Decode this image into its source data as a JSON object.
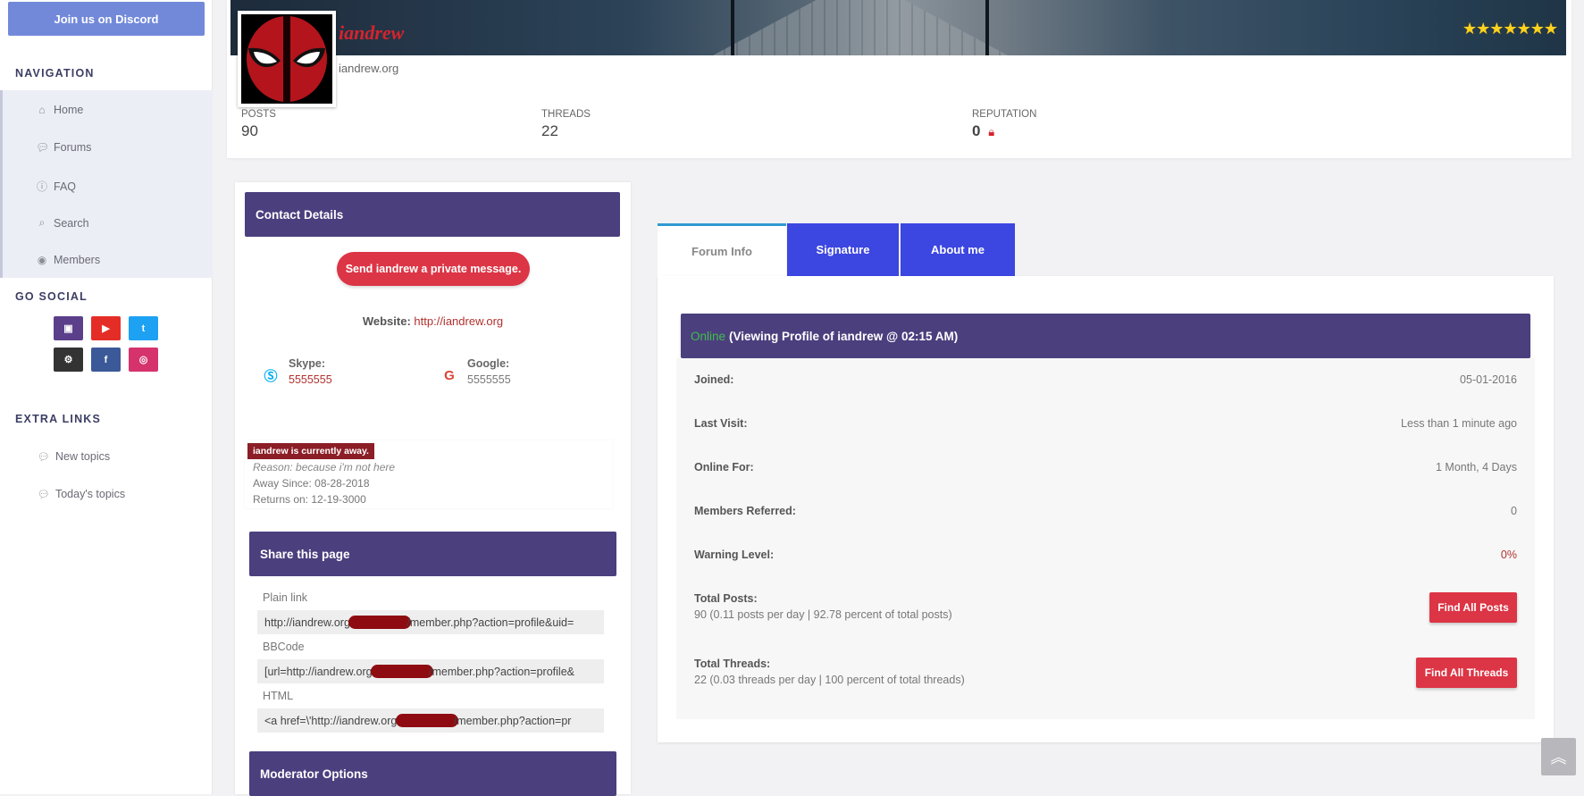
{
  "sidebar": {
    "discord_label": "Join us on Discord",
    "nav_heading": "NAVIGATION",
    "nav_items": [
      {
        "label": "Home",
        "icon": "home-icon"
      },
      {
        "label": "Forums",
        "icon": "comment-icon"
      },
      {
        "label": "FAQ",
        "icon": "question-icon"
      },
      {
        "label": "Search",
        "icon": "search-icon"
      },
      {
        "label": "Members",
        "icon": "user-icon"
      }
    ],
    "social_heading": "GO SOCIAL",
    "social": [
      {
        "name": "twitch-icon",
        "color": "#5b3f8a",
        "glyph": "▣"
      },
      {
        "name": "youtube-icon",
        "color": "#e52d27",
        "glyph": "▶"
      },
      {
        "name": "twitter-icon",
        "color": "#1da1f2",
        "glyph": "t"
      },
      {
        "name": "steam-icon",
        "color": "#333333",
        "glyph": "⚙"
      },
      {
        "name": "facebook-icon",
        "color": "#3b5998",
        "glyph": "f"
      },
      {
        "name": "instagram-icon",
        "color": "#d6336c",
        "glyph": "◎"
      }
    ],
    "extra_heading": "EXTRA LINKS",
    "extra_items": [
      {
        "label": "New topics",
        "icon": "comment-icon"
      },
      {
        "label": "Today's topics",
        "icon": "comment-icon"
      }
    ]
  },
  "profile": {
    "username": "iandrew",
    "user_title": "iandrew.org",
    "stars": "★★★★★★★",
    "stats": {
      "posts_label": "POSTS",
      "posts": "90",
      "threads_label": "THREADS",
      "threads": "22",
      "reputation_label": "REPUTATION",
      "reputation": "0"
    }
  },
  "contact": {
    "heading": "Contact Details",
    "pm_button": "Send iandrew a private message.",
    "website_label": "Website:",
    "website": "http://iandrew.org",
    "skype_label": "Skype:",
    "skype": "5555555",
    "google_label": "Google:",
    "google": "5555555"
  },
  "away": {
    "badge": "iandrew is currently away.",
    "reason": "Reason: because i'm not here",
    "since": "Away Since: 08-28-2018",
    "returns": "Returns on: 12-19-3000"
  },
  "share": {
    "heading": "Share this page",
    "plain_label": "Plain link",
    "plain_prefix": "http://iandrew.org/",
    "plain_suffix": "/member.php?action=profile&uid=",
    "bbcode_label": "BBCode",
    "bbcode_prefix": "[url=http://iandrew.org/",
    "bbcode_suffix": "/member.php?action=profile&",
    "html_label": "HTML",
    "html_prefix": "<a href=\\'http://iandrew.org/",
    "html_suffix": "/member.php?action=pr"
  },
  "moderator": {
    "heading": "Moderator Options"
  },
  "tabs": [
    {
      "label": "Forum Info",
      "active": true
    },
    {
      "label": "Signature",
      "active": false
    },
    {
      "label": "About me",
      "active": false
    }
  ],
  "forum_info": {
    "status": "Online",
    "status_text": "(Viewing Profile of iandrew @ 02:15 AM)",
    "joined_label": "Joined:",
    "joined": "05-01-2016",
    "last_visit_label": "Last Visit:",
    "last_visit": "Less than 1 minute ago",
    "online_for_label": "Online For:",
    "online_for": "1 Month, 4 Days",
    "referred_label": "Members Referred:",
    "referred": "0",
    "warning_label": "Warning Level:",
    "warning": "0%",
    "total_posts_label": "Total Posts:",
    "total_posts": "90 (0.11 posts per day | 92.78 percent of total posts)",
    "find_posts": "Find All Posts",
    "total_threads_label": "Total Threads:",
    "total_threads": "22 (0.03 threads per day | 100 percent of total threads)",
    "find_threads": "Find All Threads"
  },
  "colors": {
    "purple": "#4b3f7e",
    "red": "#dc3545",
    "tab_blue": "#3c46e0",
    "online_green": "#3fbf4a",
    "discord": "#7289da"
  }
}
